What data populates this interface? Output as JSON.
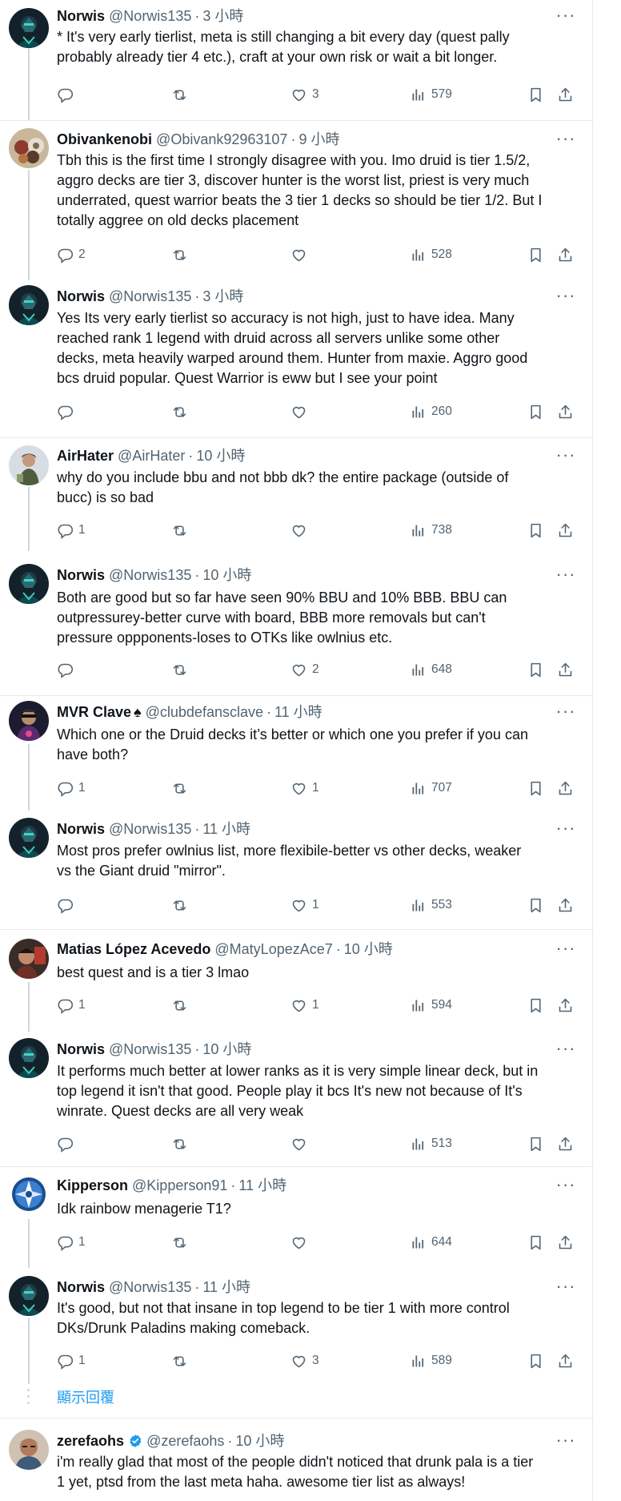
{
  "tweets": [
    {
      "name": "Norwis",
      "handle": "@Norwis135",
      "time": "3 小時",
      "text": "* It's very early tierlist, meta is still changing a bit every day (quest pally\nprobably already tier 4 etc.), craft at your own risk or wait a bit longer.",
      "replies": "",
      "retweets": "",
      "likes": "3",
      "views": "579"
    },
    {
      "name": "Obivankenobi",
      "handle": "@Obivank92963107",
      "time": "9 小時",
      "text": "Tbh this is the first time I strongly disagree with you. Imo druid is tier 1.5/2,\naggro decks are tier 3, discover hunter is the worst list, priest is very much\nunderrated, quest warrior beats the 3 tier 1 decks so should be tier 1/2. But I\ntotally aggree on old decks placement",
      "replies": "2",
      "retweets": "",
      "likes": "",
      "views": "528"
    },
    {
      "name": "Norwis",
      "handle": "@Norwis135",
      "time": "3 小時",
      "text": "Yes Its very early tierlist so accuracy is not high, just to have idea. Many\nreached rank 1 legend with druid across all servers unlike some other\ndecks, meta heavily warped around them. Hunter from maxie. Aggro good\nbcs druid popular. Quest Warrior is eww but I see your point",
      "replies": "",
      "retweets": "",
      "likes": "",
      "views": "260"
    },
    {
      "name": "AirHater",
      "handle": "@AirHater",
      "time": "10 小時",
      "text": "why do you include bbu and not bbb dk? the entire package (outside of\nbucc) is so bad",
      "replies": "1",
      "retweets": "",
      "likes": "",
      "views": "738"
    },
    {
      "name": "Norwis",
      "handle": "@Norwis135",
      "time": "10 小時",
      "text": "Both are good but so far have seen 90% BBU and 10% BBB. BBU can\noutpressurey-better curve with board, BBB more removals but can't\npressure oppponents-loses to OTKs like owlnius etc.",
      "replies": "",
      "retweets": "",
      "likes": "2",
      "views": "648"
    },
    {
      "name": "MVR Clave",
      "name_suffix": "♠",
      "handle": "@clubdefansclave",
      "time": "11 小時",
      "text": "Which one or the Druid decks it’s better or which one you prefer if you can\nhave both?",
      "replies": "1",
      "retweets": "",
      "likes": "1",
      "views": "707"
    },
    {
      "name": "Norwis",
      "handle": "@Norwis135",
      "time": "11 小時",
      "text": "Most pros prefer owlnius list, more flexibile-better vs other decks, weaker\nvs the Giant druid \"mirror\".",
      "replies": "",
      "retweets": "",
      "likes": "1",
      "views": "553"
    },
    {
      "name": "Matias López Acevedo",
      "handle": "@MatyLopezAce7",
      "time": "10 小時",
      "text": "best quest and is a tier 3 lmao",
      "replies": "1",
      "retweets": "",
      "likes": "1",
      "views": "594"
    },
    {
      "name": "Norwis",
      "handle": "@Norwis135",
      "time": "10 小時",
      "text": "It performs much better at lower ranks as it is very simple linear deck, but in\ntop legend it isn't that good. People play it bcs It's new not because of It's\nwinrate. Quest decks are all very weak",
      "replies": "",
      "retweets": "",
      "likes": "",
      "views": "513"
    },
    {
      "name": "Kipperson",
      "handle": "@Kipperson91",
      "time": "11 小時",
      "text": "Idk rainbow menagerie T1?",
      "replies": "1",
      "retweets": "",
      "likes": "",
      "views": "644"
    },
    {
      "name": "Norwis",
      "handle": "@Norwis135",
      "time": "11 小時",
      "text": "It's good, but not that insane in top legend to be tier 1 with more control\nDKs/Drunk Paladins making comeback.",
      "replies": "1",
      "retweets": "",
      "likes": "3",
      "views": "589"
    },
    {
      "name": "zerefaohs",
      "handle": "@zerefaohs",
      "time": "10 小時",
      "text": "i'm really glad that most of the people didn't noticed that drunk pala is a tier\n1 yet, ptsd from the last meta haha. awesome tier list as always!",
      "replies": "",
      "retweets": "",
      "likes": "",
      "views": ""
    }
  ],
  "separator_dot": "·",
  "more_label": "···",
  "show_replies_label": "顯示回覆",
  "colors": {
    "text": "#0f1419",
    "muted": "#536471",
    "link": "#1d9bf0",
    "border": "#e7e9ea",
    "thread_line": "#cfd9de"
  },
  "icons": [
    "reply-icon",
    "retweet-icon",
    "like-icon",
    "views-icon",
    "bookmark-icon",
    "share-icon",
    "more-icon",
    "verified-icon"
  ]
}
